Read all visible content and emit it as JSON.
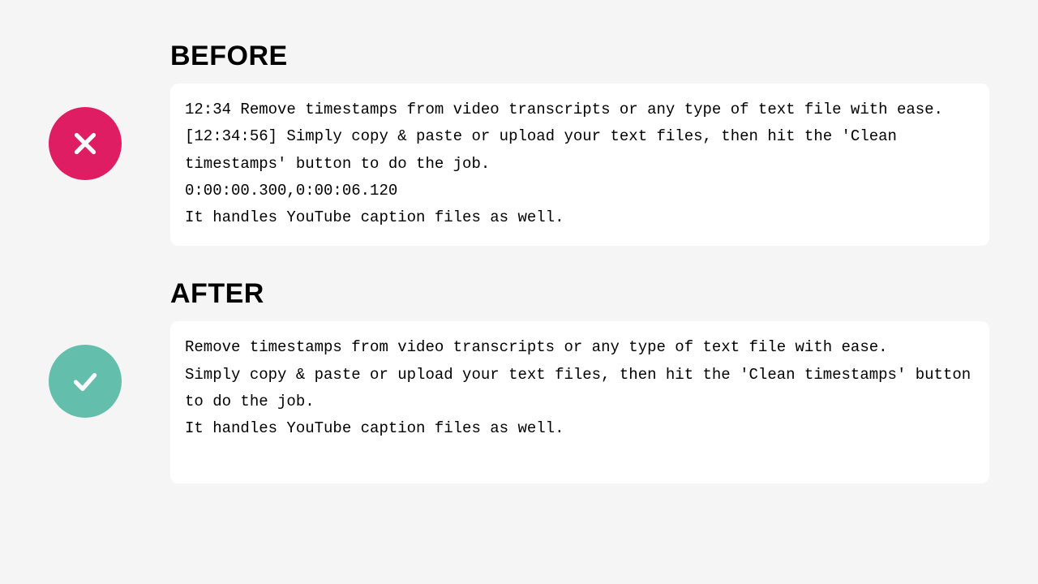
{
  "before": {
    "heading": "BEFORE",
    "text": "12:34 Remove timestamps from video transcripts or any type of text file with ease.\n[12:34:56] Simply copy & paste or upload your text files, then hit the 'Clean timestamps' button to do the job.\n0:00:00.300,0:00:06.120\nIt handles YouTube caption files as well."
  },
  "after": {
    "heading": "AFTER",
    "text": "Remove timestamps from video transcripts or any type of text file with ease.\nSimply copy & paste or upload your text files, then hit the 'Clean timestamps' button to do the job.\nIt handles YouTube caption files as well."
  },
  "icons": {
    "cross_semantic": "cross-icon",
    "check_semantic": "check-icon"
  },
  "colors": {
    "cross_bg": "#df1d62",
    "check_bg": "#63beab",
    "page_bg": "#f5f5f5",
    "card_bg": "#ffffff"
  }
}
